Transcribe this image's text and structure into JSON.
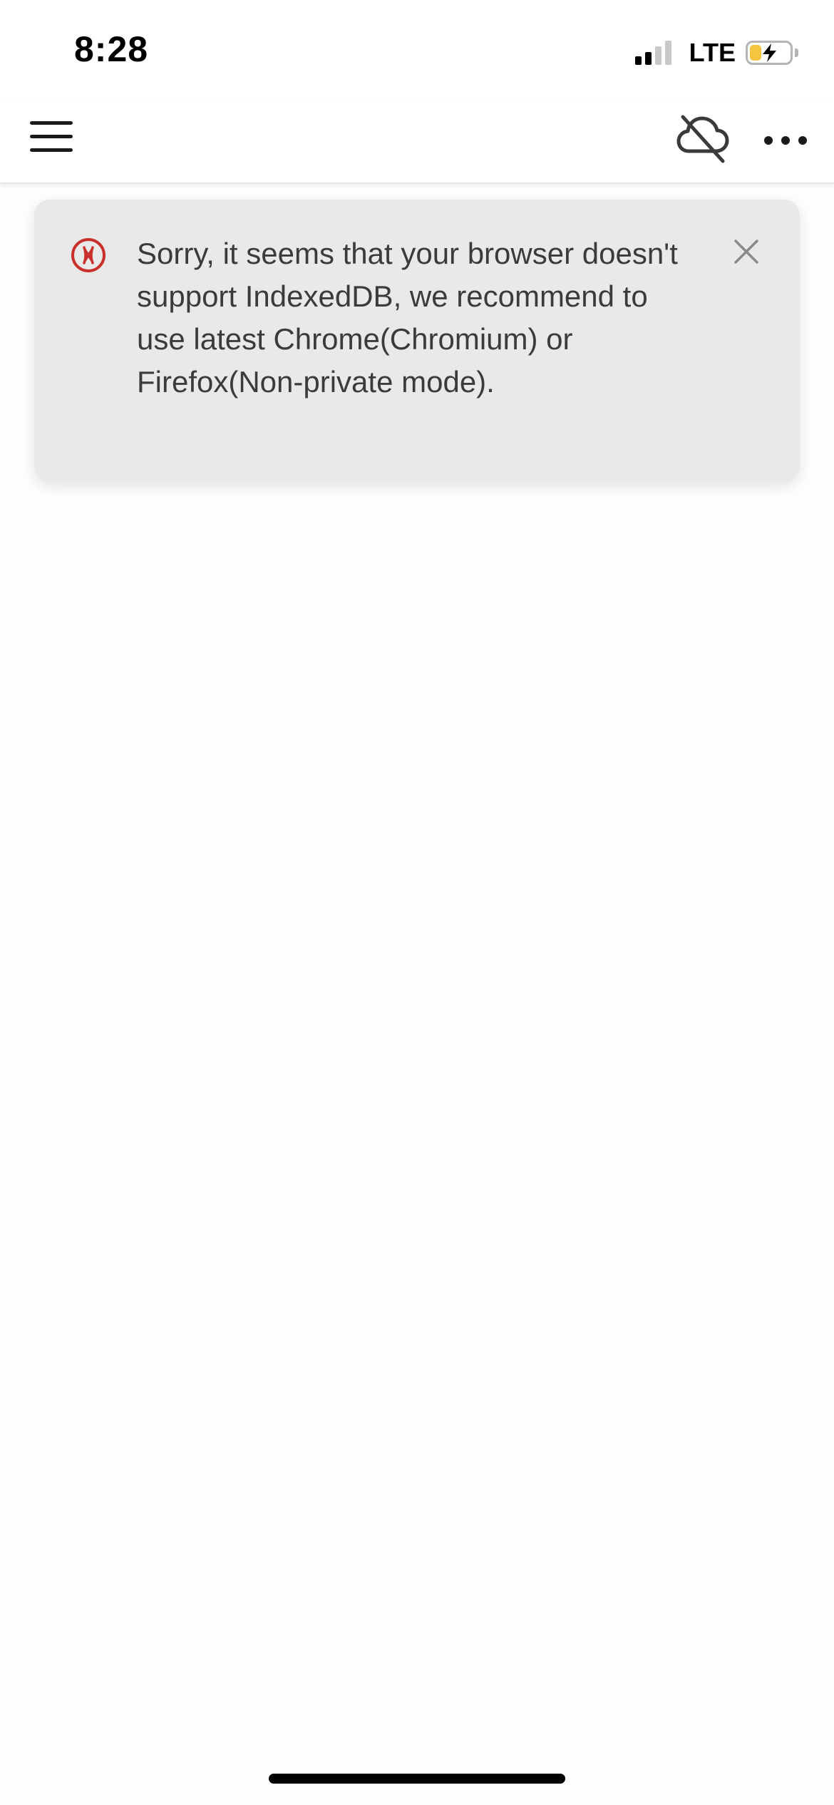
{
  "status_bar": {
    "time": "8:28",
    "network": "LTE",
    "signal_bars_filled": 2,
    "signal_bars_total": 4,
    "battery_level": 0.3,
    "charging": true,
    "battery_fill_color": "#f5c542"
  },
  "toolbar": {
    "menu_icon": "hamburger-menu-icon",
    "sync_icon": "cloud-off-icon",
    "more_icon": "more-horizontal-icon"
  },
  "notification": {
    "type": "error",
    "icon": "error-circle-icon",
    "icon_color": "#c9302c",
    "message": "Sorry, it seems that your browser doesn't support IndexedDB, we recommend to use latest Chrome(Chromium) or Firefox(Non-private mode).",
    "close_icon": "close-icon"
  }
}
